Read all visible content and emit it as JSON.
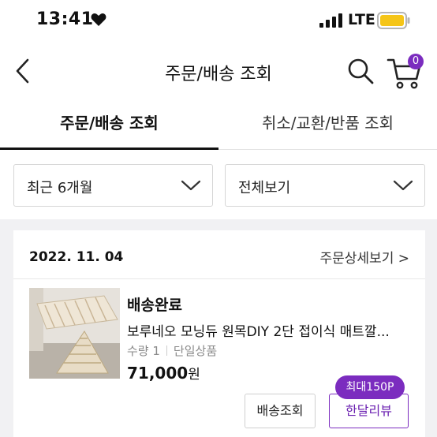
{
  "status_bar": {
    "time": "13:41",
    "network": "LTE"
  },
  "header": {
    "title": "주문/배송 조회",
    "cart_count": "0"
  },
  "tabs": [
    {
      "label": "주문/배송 조회",
      "active": true
    },
    {
      "label": "취소/교환/반품 조회",
      "active": false
    }
  ],
  "filters": {
    "period": "최근 6개월",
    "view": "전체보기"
  },
  "order": {
    "date": "2022. 11. 04",
    "detail_link": "주문상세보기 >",
    "status": "배송완료",
    "product_name": "보루네오 모닝듀 원목DIY 2단 접이식 매트깔...",
    "quantity": "수량 1",
    "option": "단일상품",
    "price": "71,000",
    "price_unit": "원",
    "buttons": {
      "tracking": "배송조회",
      "review": "한달리뷰"
    },
    "reward_badge": "최대150P"
  },
  "colors": {
    "accent": "#7b2cbf",
    "battery": "#f5c518"
  }
}
